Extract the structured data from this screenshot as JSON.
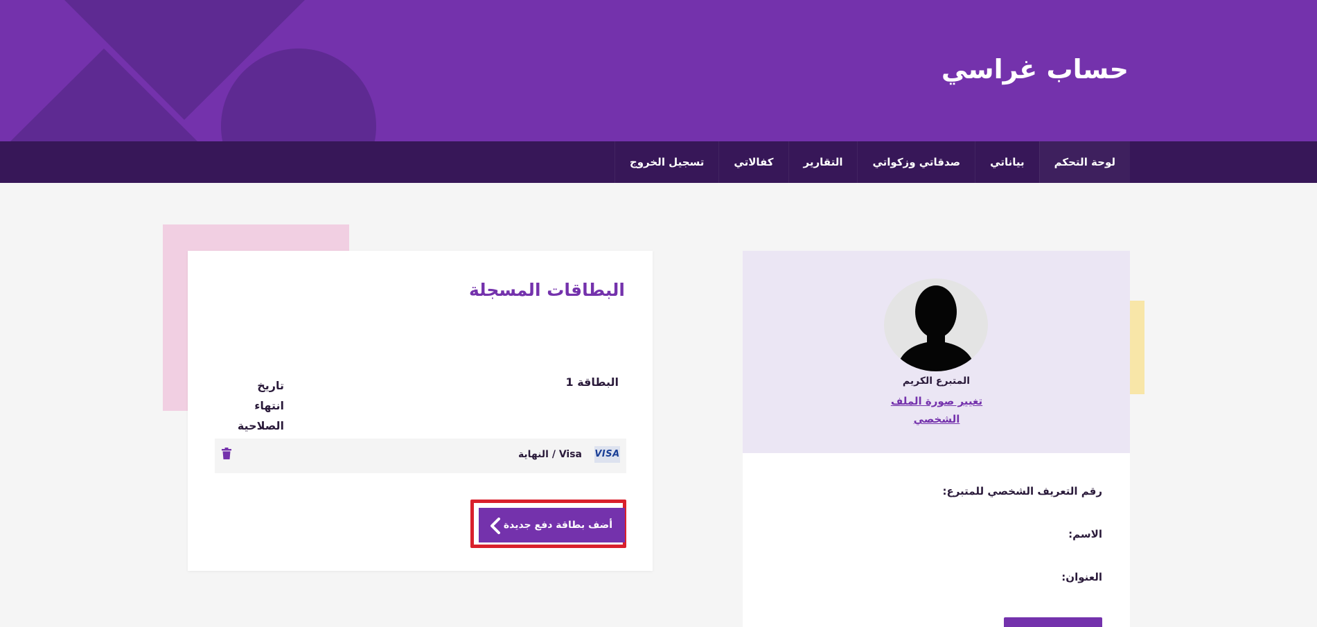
{
  "header": {
    "title": "حساب غراسي"
  },
  "nav": {
    "items": [
      {
        "label": "لوحة التحكم"
      },
      {
        "label": "بياناتي"
      },
      {
        "label": "صدقاتي وزكواتي"
      },
      {
        "label": "التقارير"
      },
      {
        "label": "كفالاتي"
      },
      {
        "label": "تسجيل الخروج"
      }
    ]
  },
  "cards": {
    "title": "البطاقات المسجلة",
    "col_card": "البطاقة 1",
    "col_expiry": "تاريخ انتهاء الصلاحية",
    "rows": [
      {
        "brand": "VISA",
        "description": "Visa / النهاية"
      }
    ],
    "add_button": "أضف بطاقة دفع جديدة"
  },
  "profile": {
    "name": "المتبرع الكريم",
    "change_photo": "تغيير صورة الملف الشخصي",
    "fields": {
      "donor_id_label": "رقم التعريف الشخصي للمتبرع:",
      "name_label": "الاسم:",
      "address_label": "العنوان:"
    }
  },
  "colors": {
    "brand_purple": "#7432ac",
    "nav_dark": "#371758",
    "highlight_red": "#d9202c"
  },
  "icons": {
    "trash": "trash-icon",
    "chevron": "chevron-left-icon"
  }
}
